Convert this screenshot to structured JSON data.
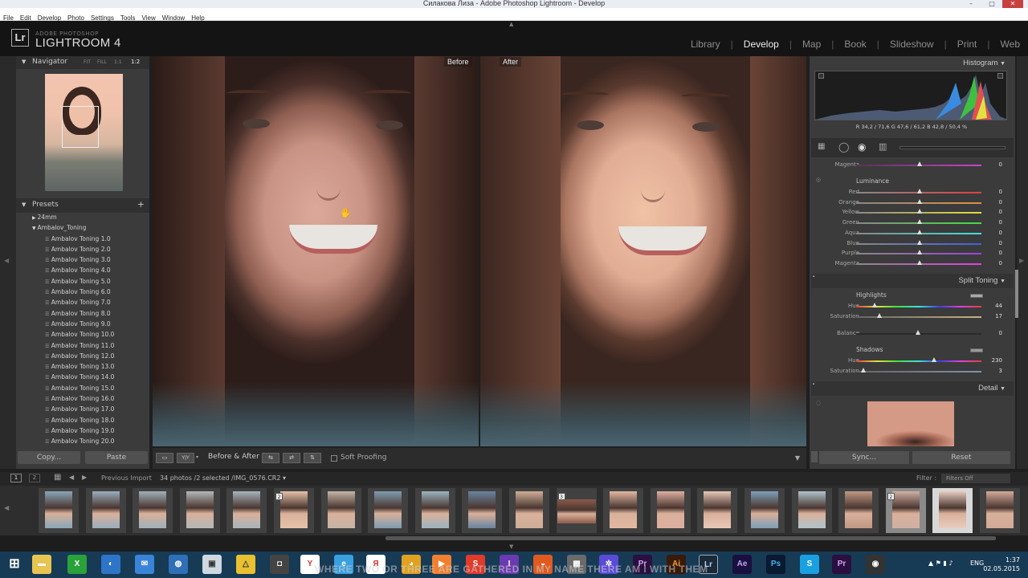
{
  "window": {
    "title": "Силакова Лиза - Adobe Photoshop Lightroom - Develop",
    "minimize": "–",
    "maximize": "□",
    "close": "✕"
  },
  "menu": [
    "File",
    "Edit",
    "Develop",
    "Photo",
    "Settings",
    "Tools",
    "View",
    "Window",
    "Help"
  ],
  "brand": {
    "logo": "Lr",
    "company": "ADOBE PHOTOSHOP",
    "product": "LIGHTROOM 4"
  },
  "modules": [
    "Library",
    "Develop",
    "Map",
    "Book",
    "Slideshow",
    "Print",
    "Web"
  ],
  "active_module": "Develop",
  "navigator": {
    "title": "Navigator",
    "zoom": [
      "FIT",
      "FILL",
      "1:1",
      "1:2"
    ]
  },
  "presets": {
    "title": "Presets",
    "add": "+",
    "folders": [
      "24mm",
      "Ambalov_Toning"
    ],
    "items": [
      "Ambalov Toning 1.0",
      "Ambalov Toning 2.0",
      "Ambalov Toning 3.0",
      "Ambalov Toning 4.0",
      "Ambalov Toning 5.0",
      "Ambalov Toning 6.0",
      "Ambalov Toning 7.0",
      "Ambalov Toning 8.0",
      "Ambalov Toning 9.0",
      "Ambalov Toning 10.0",
      "Ambalov Toning 11.0",
      "Ambalov Toning 12.0",
      "Ambalov Toning 13.0",
      "Ambalov Toning 14.0",
      "Ambalov Toning 15.0",
      "Ambalov Toning 16.0",
      "Ambalov Toning 17.0",
      "Ambalov Toning 18.0",
      "Ambalov Toning 19.0",
      "Ambalov Toning 20.0"
    ]
  },
  "left_buttons": {
    "copy": "Copy...",
    "paste": "Paste"
  },
  "compare": {
    "before": "Before",
    "after": "After"
  },
  "toolbar": {
    "view_label": "Before & After :",
    "soft_proofing": "Soft Proofing",
    "yy": "Y|Y"
  },
  "histogram": {
    "title": "Histogram",
    "readout": "R  34,2 / 71,6   G  47,6 / 61,2   B  42,8 / 50,4  %"
  },
  "hsl": {
    "top_label": "Magenta",
    "top_value": "0",
    "section": "Luminance",
    "rows": [
      {
        "name": "Red",
        "value": "0"
      },
      {
        "name": "Orange",
        "value": "0"
      },
      {
        "name": "Yellow",
        "value": "0"
      },
      {
        "name": "Green",
        "value": "0"
      },
      {
        "name": "Aqua",
        "value": "0"
      },
      {
        "name": "Blue",
        "value": "0"
      },
      {
        "name": "Purple",
        "value": "0"
      },
      {
        "name": "Magenta",
        "value": "0"
      }
    ]
  },
  "split_toning": {
    "title": "Split Toning",
    "highlights": "Highlights",
    "hl_hue": {
      "name": "Hue",
      "value": "44"
    },
    "hl_sat": {
      "name": "Saturation",
      "value": "17"
    },
    "balance": {
      "name": "Balance",
      "value": "0"
    },
    "shadows": "Shadows",
    "sh_hue": {
      "name": "Hue",
      "value": "230"
    },
    "sh_sat": {
      "name": "Saturation",
      "value": "3"
    }
  },
  "detail": {
    "title": "Detail"
  },
  "right_buttons": {
    "sync": "Sync...",
    "reset": "Reset"
  },
  "filmbar": {
    "pages": [
      "1",
      "2"
    ],
    "source": "Previous Import",
    "info": "34 photos /2 selected /IMG_0576.CR2 ▾",
    "filter_label": "Filter :",
    "filter_value": "Filters Off"
  },
  "thumb_badges": [
    "2",
    "3",
    "2"
  ],
  "subtitle": "WHERE TWO OR THREE ARE GATHERED IN MY NAME THERE AM I WITH THEM",
  "tray": {
    "lang": "ENG",
    "time": "1:37",
    "date": "02.05.2015"
  },
  "taskbar_apps": [
    "Pr",
    "Ai",
    "Lr",
    "Ae",
    "Ps",
    "S",
    "Pr"
  ]
}
